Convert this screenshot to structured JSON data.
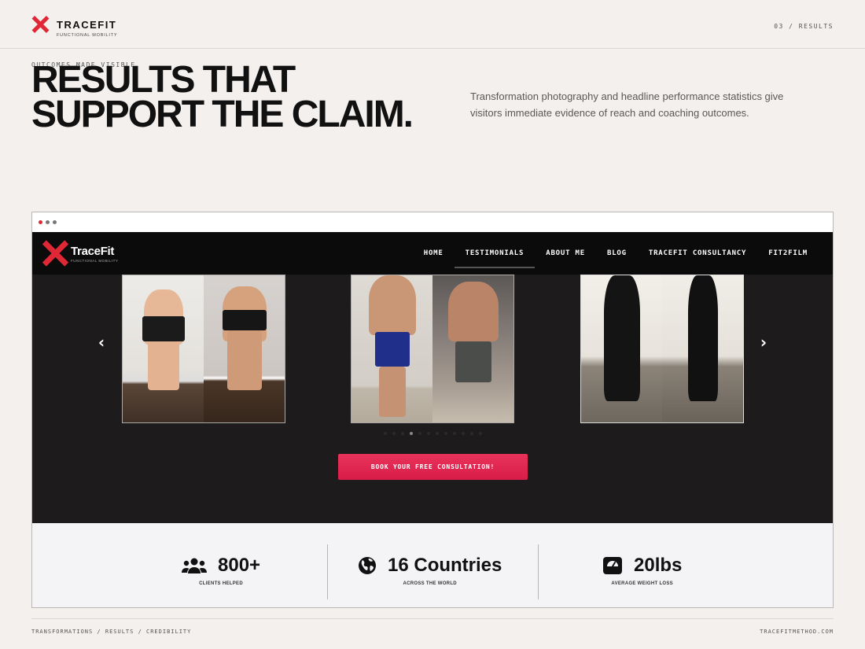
{
  "header": {
    "brand_name": "TRACEFIT",
    "brand_sub": "FUNCTIONAL MOBILITY",
    "page_label": "03 / RESULTS"
  },
  "intro": {
    "eyebrow": "OUTCOMES MADE VISIBLE",
    "headline_line1": "RESULTS THAT",
    "headline_line2": "SUPPORT THE CLAIM.",
    "lede": "Transformation photography and headline performance statistics give visitors immediate evidence of reach and coaching outcomes."
  },
  "site": {
    "logo_text": "TraceFit",
    "logo_sub": "FUNCTIONAL MOBILITY",
    "nav": [
      {
        "label": "HOME",
        "active": false
      },
      {
        "label": "TESTIMONIALS",
        "active": true
      },
      {
        "label": "ABOUT ME",
        "active": false
      },
      {
        "label": "BLOG",
        "active": false
      },
      {
        "label": "TRACEFIT CONSULTANCY",
        "active": false
      },
      {
        "label": "FIT2FILM",
        "active": false
      }
    ],
    "carousel_prev_icon": "chevron-left-icon",
    "carousel_next_icon": "chevron-right-icon",
    "carousel_dot_count": 12,
    "carousel_active_dot": 3,
    "cta_label": "BOOK YOUR FREE CONSULTATION!"
  },
  "stats": [
    {
      "icon": "users-icon",
      "value": "800+",
      "caption": "CLIENTS HELPED"
    },
    {
      "icon": "globe-icon",
      "value": "16 Countries",
      "caption": "ACROSS THE WORLD"
    },
    {
      "icon": "scale-icon",
      "value": "20lbs",
      "caption": "AVERAGE WEIGHT LOSS"
    }
  ],
  "footer": {
    "left": "TRANSFORMATIONS / RESULTS / CREDIBILITY",
    "right": "TRACEFITMETHOD.COM"
  },
  "colors": {
    "accent": "#e02735",
    "cta": "#e0264f",
    "page_bg": "#f3f0ee",
    "site_bg": "#1d1b1c"
  }
}
